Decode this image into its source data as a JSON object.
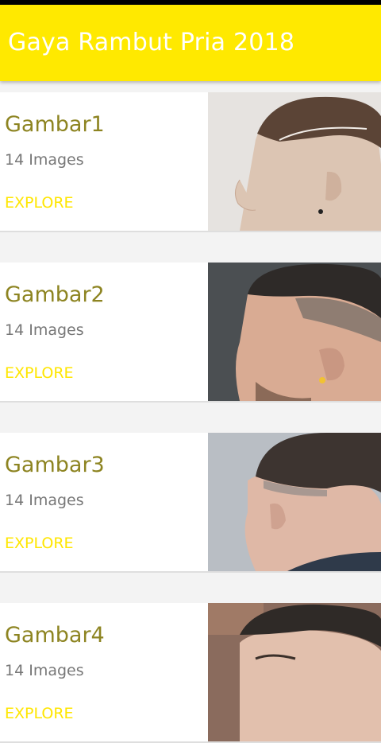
{
  "app": {
    "title": "Gaya Rambut Pria 2018"
  },
  "items": [
    {
      "name": "Gambar1",
      "count": "14 Images",
      "action": "EXPLORE"
    },
    {
      "name": "Gambar2",
      "count": "14 Images",
      "action": "EXPLORE"
    },
    {
      "name": "Gambar3",
      "count": "14 Images",
      "action": "EXPLORE"
    },
    {
      "name": "Gambar4",
      "count": "14 Images",
      "action": "EXPLORE"
    }
  ],
  "colors": {
    "appbar": "#ffe900",
    "item_title": "#8d8421",
    "explore": "#ffe600",
    "background": "#f3f3f3"
  }
}
